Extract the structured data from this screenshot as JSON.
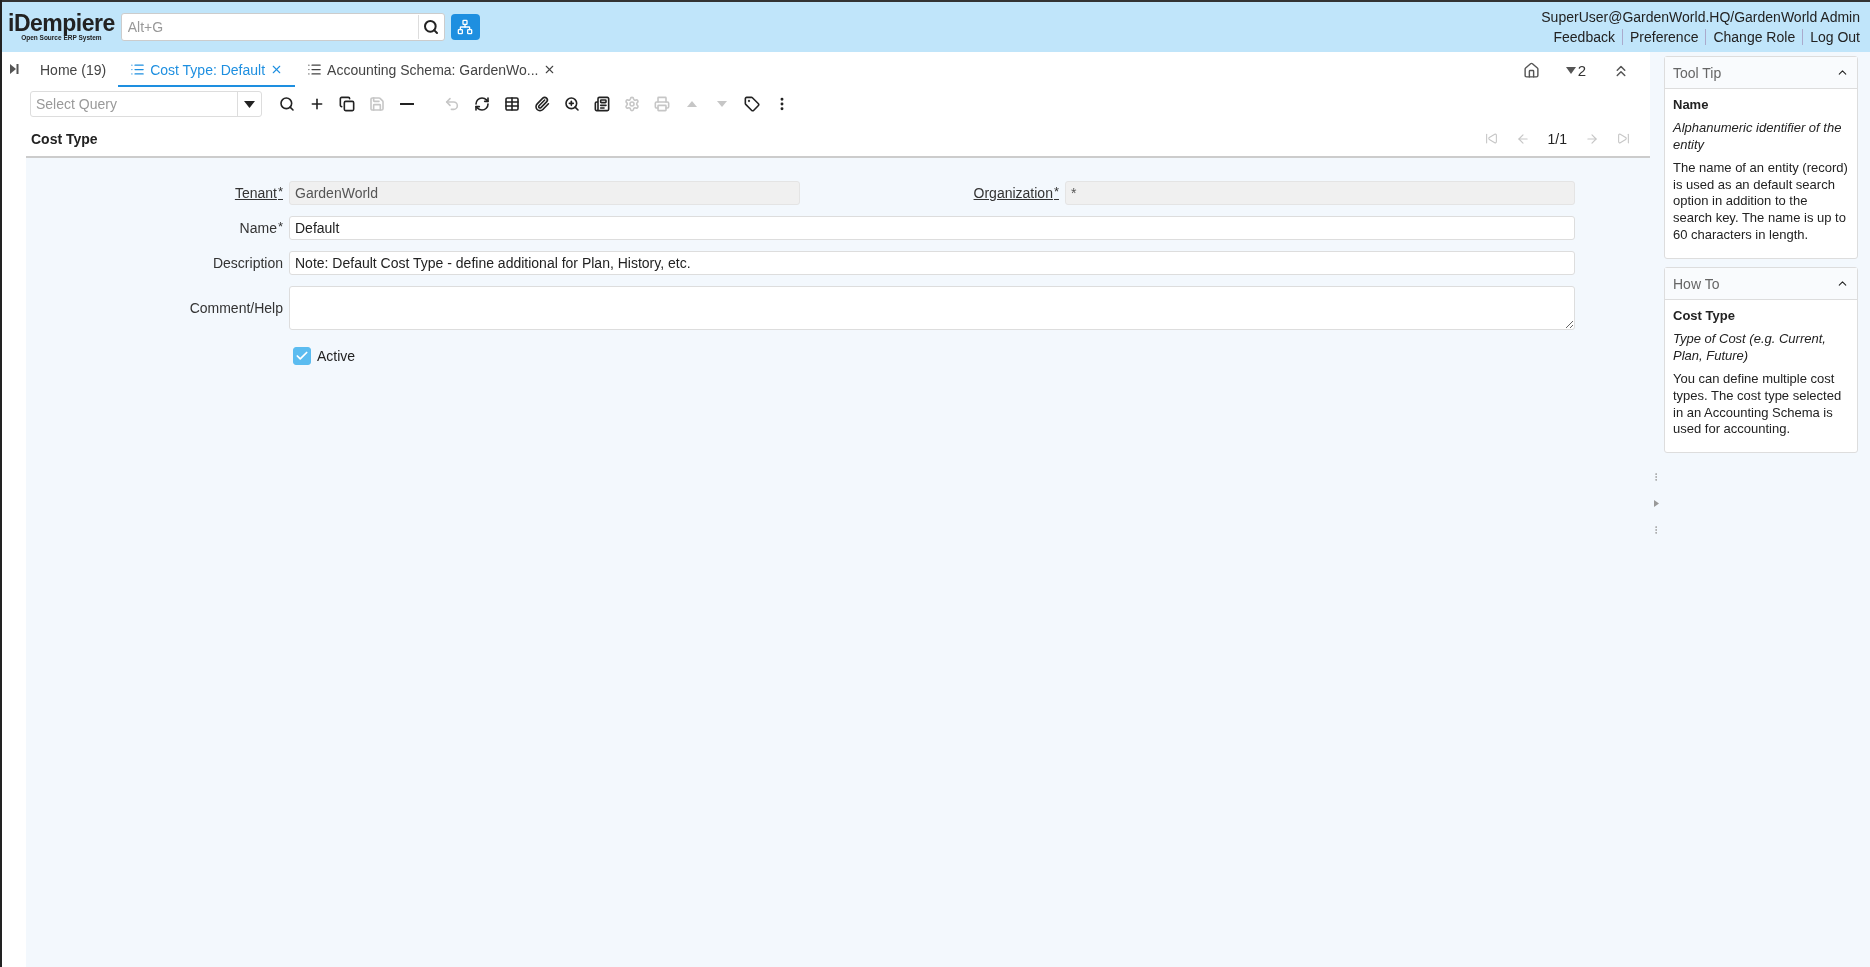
{
  "header": {
    "logo": {
      "name": "iDempiere",
      "tagline": "Open Source ERP System"
    },
    "search": {
      "placeholder": "Alt+G"
    },
    "user": "SuperUser@GardenWorld.HQ/GardenWorld Admin",
    "links": [
      "Feedback",
      "Preference",
      "Change Role",
      "Log Out"
    ]
  },
  "tabs": [
    {
      "label": "Home (19)",
      "kind": "home",
      "selected": false
    },
    {
      "label": "Cost Type: Default",
      "kind": "window",
      "selected": true
    },
    {
      "label": "Accounting Schema: GardenWo...",
      "kind": "window",
      "selected": false
    }
  ],
  "window_count": "2",
  "toolbar": {
    "query": {
      "placeholder": "Select Query"
    },
    "buttons": [
      {
        "disabled": false
      },
      {
        "disabled": false
      },
      {
        "disabled": false
      },
      {
        "disabled": true
      },
      {
        "disabled": false
      },
      {
        "disabled": true
      },
      {
        "disabled": false
      },
      {
        "disabled": false
      },
      {
        "disabled": false
      },
      {
        "disabled": false
      },
      {
        "disabled": false
      },
      {
        "disabled": true
      },
      {
        "disabled": true
      },
      {
        "disabled": true
      },
      {
        "disabled": true
      },
      {
        "disabled": false
      },
      {
        "disabled": false
      }
    ]
  },
  "record": {
    "title": "Cost Type",
    "position": "1/1"
  },
  "form_rows": [
    [
      {
        "kind": "text",
        "label": "Tenant",
        "required_mark": "*",
        "zoomable": true,
        "readonly": true,
        "value": "GardenWorld"
      },
      {
        "kind": "text",
        "label": "Organization",
        "required_mark": "*",
        "zoomable": true,
        "readonly": true,
        "value": "*"
      }
    ],
    [
      {
        "kind": "text",
        "label": "Name",
        "required_mark": "*",
        "zoomable": false,
        "readonly": false,
        "value": "Default"
      }
    ],
    [
      {
        "kind": "text",
        "label": "Description",
        "zoomable": false,
        "readonly": false,
        "value": "Note: Default Cost Type - define additional for Plan, History, etc."
      }
    ],
    [
      {
        "kind": "textarea",
        "label": "Comment/Help",
        "zoomable": false,
        "readonly": false
      }
    ],
    [
      {
        "kind": "checkbox",
        "label": "Active",
        "checked": true
      }
    ]
  ],
  "side_panels": [
    {
      "title": "Tool Tip",
      "expanded": true,
      "heading": "Name",
      "summary": "Alphanumeric identifier of the entity",
      "body": "The name of an entity (record) is used as an default search option in addition to the search key. The name is up to 60 characters in length."
    },
    {
      "title": "How To",
      "expanded": true,
      "heading": "Cost Type",
      "summary": "Type of Cost (e.g. Current, Plan, Future)",
      "body": "You can define multiple cost types. The cost type selected in an Accounting Schema is used for accounting."
    }
  ]
}
